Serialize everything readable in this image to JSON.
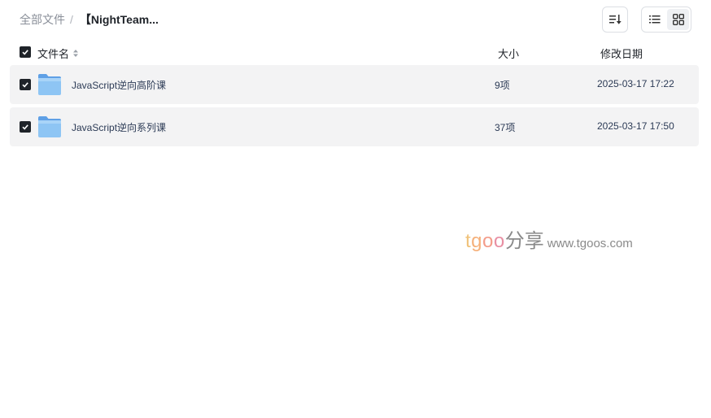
{
  "breadcrumb": {
    "root": "全部文件",
    "separator": "/",
    "current": "【NightTeam..."
  },
  "toolbar": {
    "sort_icon": "sort-icon",
    "list_view_icon": "list-view-icon",
    "grid_view_icon": "grid-view-icon",
    "active_view": "grid"
  },
  "header": {
    "name": "文件名",
    "size": "大小",
    "date": "修改日期",
    "all_checked": true
  },
  "rows": [
    {
      "name": "JavaScript逆向高阶课",
      "size": "9项",
      "date": "2025-03-17 17:22",
      "checked": true,
      "icon": "folder-icon"
    },
    {
      "name": "JavaScript逆向系列课",
      "size": "37项",
      "date": "2025-03-17 17:50",
      "checked": true,
      "icon": "folder-icon"
    }
  ],
  "watermark": {
    "brand": "tgoo",
    "share": "分享",
    "url": "www.tgoos.com"
  },
  "colors": {
    "row_bg": "#f3f3f4",
    "checkbox": "#1f2329",
    "folder": "#7fb8ef",
    "text": "#2b3a55"
  }
}
